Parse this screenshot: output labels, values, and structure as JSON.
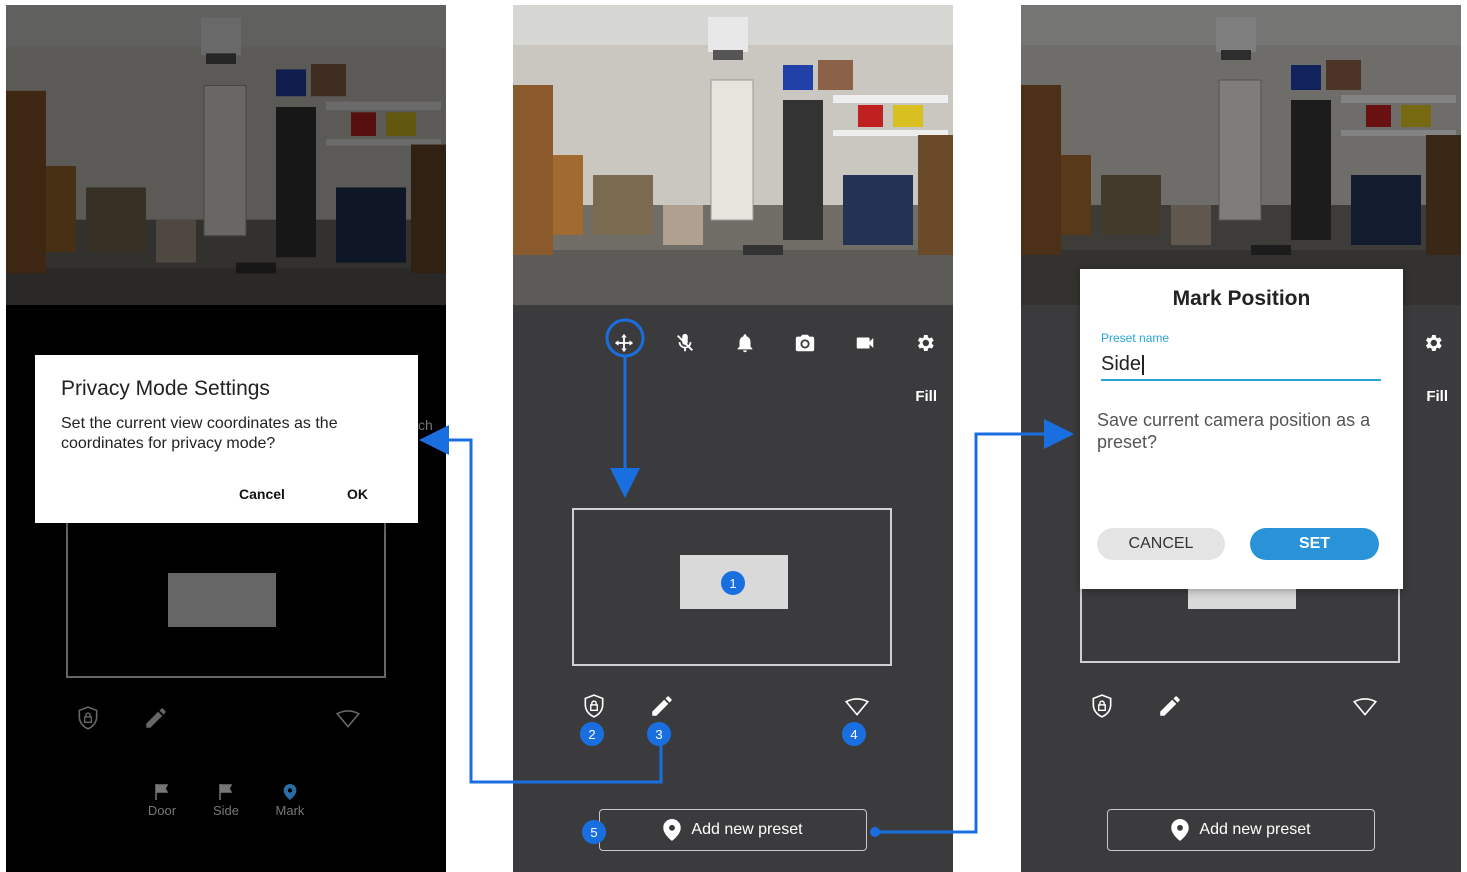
{
  "left_panel": {
    "dialog_title": "Privacy Mode Settings",
    "dialog_text": "Set the current view coordinates as the coordinates for privacy mode?",
    "cancel_label": "Cancel",
    "ok_label": "OK",
    "partial_label": "ch",
    "presets": [
      {
        "label": "Door",
        "icon": "flag-icon"
      },
      {
        "label": "Side",
        "icon": "flag-icon"
      },
      {
        "label": "Mark",
        "icon": "map-pin-icon",
        "active": true
      }
    ]
  },
  "middle_panel": {
    "toolbar_icons": [
      "move-icon",
      "mic-off-icon",
      "bell-icon",
      "camera-icon",
      "video-icon",
      "gear-icon"
    ],
    "fill_label": "Fill",
    "add_preset_label": "Add new preset",
    "badges": [
      "1",
      "2",
      "3",
      "4",
      "5"
    ]
  },
  "right_panel": {
    "fill_label": "Fill",
    "dialog_title": "Mark Position",
    "field_label": "Preset name",
    "field_value": "Side",
    "dialog_text": "Save current camera position as a preset?",
    "cancel_label": "CANCEL",
    "set_label": "SET",
    "add_preset_label": "Add new preset"
  },
  "colors": {
    "accent_blue": "#1a6fe0",
    "panel_bg": "#3b3b3d",
    "dialog_accent": "#2aa5d8",
    "set_button": "#2a93d8"
  }
}
